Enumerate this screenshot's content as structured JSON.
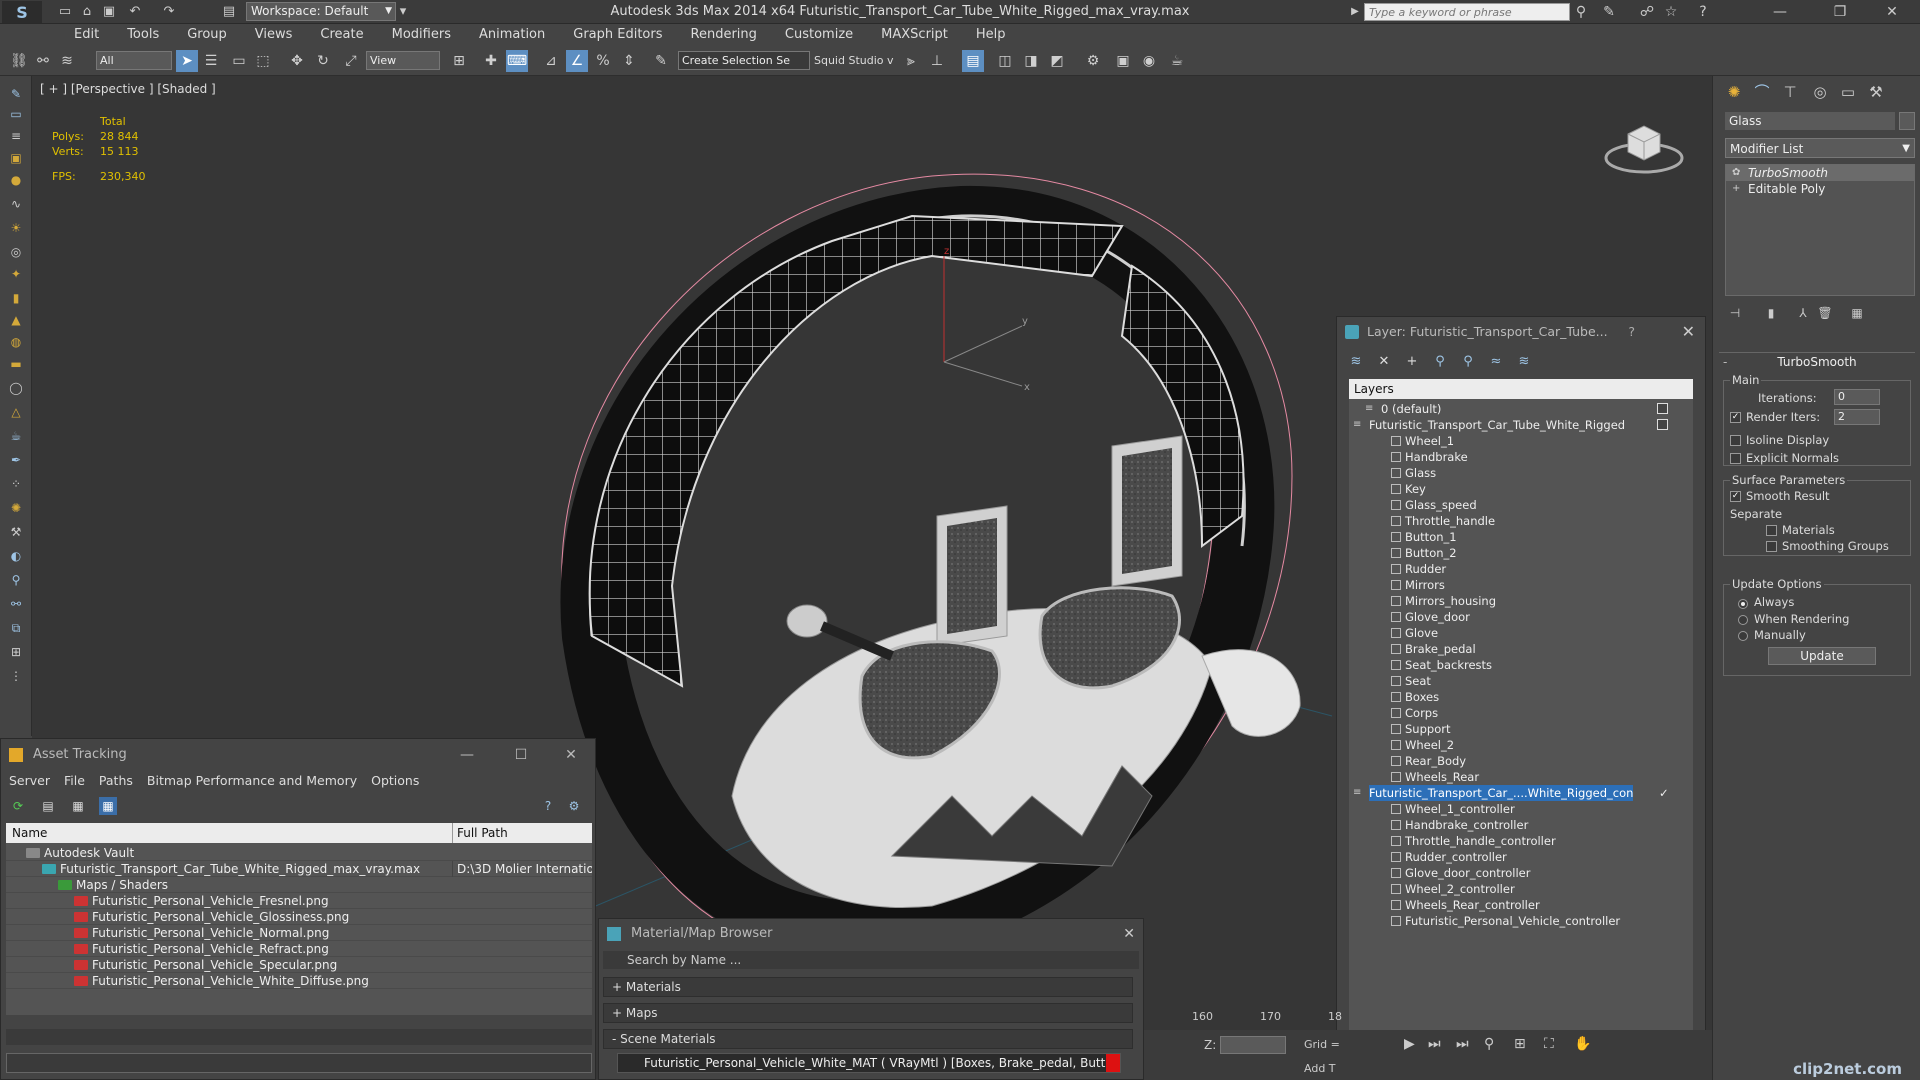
{
  "titlebar": {
    "workspace": "Workspace: Default",
    "title": "Autodesk 3ds Max  2014 x64     Futuristic_Transport_Car_Tube_White_Rigged_max_vray.max",
    "search_placeholder": "Type a keyword or phrase"
  },
  "menu": [
    "Edit",
    "Tools",
    "Group",
    "Views",
    "Create",
    "Modifiers",
    "Animation",
    "Graph Editors",
    "Rendering",
    "Customize",
    "MAXScript",
    "Help"
  ],
  "toolbar": {
    "filter_select": "All",
    "ref_coord": "View",
    "selection_set": "Create Selection Se",
    "squid": "Squid Studio v"
  },
  "viewport": {
    "label": "[ + ] [Perspective ] [Shaded ]",
    "stats": {
      "total_label": "Total",
      "polys_label": "Polys:",
      "polys": "28 844",
      "verts_label": "Verts:",
      "verts": "15 113",
      "fps_label": "FPS:",
      "fps": "230,340"
    },
    "gizmo": {
      "z": "z",
      "y": "y",
      "x": "x"
    }
  },
  "command_panel": {
    "object_name": "Glass",
    "modifier_list": "Modifier List",
    "stack": [
      "TurboSmooth",
      "Editable Poly"
    ],
    "turbosmooth": {
      "title": "TurboSmooth",
      "main_label": "Main",
      "iterations_label": "Iterations:",
      "iterations": "0",
      "render_iters_label": "Render Iters:",
      "render_iters": "2",
      "render_iters_checked": true,
      "isoline": "Isoline Display",
      "explicit_normals": "Explicit Normals",
      "surface_params": "Surface Parameters",
      "smooth_result": "Smooth Result",
      "smooth_result_checked": true,
      "separate": "Separate",
      "materials": "Materials",
      "smoothing_groups": "Smoothing Groups",
      "update_options": "Update Options",
      "always": "Always",
      "when_rendering": "When Rendering",
      "manually": "Manually",
      "update_button": "Update"
    }
  },
  "layer_explorer": {
    "title": "Layer: Futuristic_Transport_Car_Tube...",
    "help": "?",
    "header": "Layers",
    "rows": [
      {
        "label": "0 (default)",
        "indent": 1,
        "type": "layer",
        "vis": true
      },
      {
        "label": "Futuristic_Transport_Car_Tube_White_Rigged",
        "indent": 0,
        "type": "layer",
        "vis": true
      },
      {
        "label": "Wheel_1",
        "indent": 2,
        "type": "obj"
      },
      {
        "label": "Handbrake",
        "indent": 2,
        "type": "obj"
      },
      {
        "label": "Glass",
        "indent": 2,
        "type": "obj"
      },
      {
        "label": "Key",
        "indent": 2,
        "type": "obj"
      },
      {
        "label": "Glass_speed",
        "indent": 2,
        "type": "obj"
      },
      {
        "label": "Throttle_handle",
        "indent": 2,
        "type": "obj"
      },
      {
        "label": "Button_1",
        "indent": 2,
        "type": "obj"
      },
      {
        "label": "Button_2",
        "indent": 2,
        "type": "obj"
      },
      {
        "label": "Rudder",
        "indent": 2,
        "type": "obj"
      },
      {
        "label": "Mirrors",
        "indent": 2,
        "type": "obj"
      },
      {
        "label": "Mirrors_housing",
        "indent": 2,
        "type": "obj"
      },
      {
        "label": "Glove_door",
        "indent": 2,
        "type": "obj"
      },
      {
        "label": "Glove",
        "indent": 2,
        "type": "obj"
      },
      {
        "label": "Brake_pedal",
        "indent": 2,
        "type": "obj"
      },
      {
        "label": "Seat_backrests",
        "indent": 2,
        "type": "obj"
      },
      {
        "label": "Seat",
        "indent": 2,
        "type": "obj"
      },
      {
        "label": "Boxes",
        "indent": 2,
        "type": "obj"
      },
      {
        "label": "Corps",
        "indent": 2,
        "type": "obj"
      },
      {
        "label": "Support",
        "indent": 2,
        "type": "obj"
      },
      {
        "label": "Wheel_2",
        "indent": 2,
        "type": "obj"
      },
      {
        "label": "Rear_Body",
        "indent": 2,
        "type": "obj"
      },
      {
        "label": "Wheels_Rear",
        "indent": 2,
        "type": "obj"
      },
      {
        "label": "Futuristic_Transport_Car_....White_Rigged_con",
        "indent": 0,
        "type": "layer",
        "selected": true,
        "check": true
      },
      {
        "label": "Wheel_1_controller",
        "indent": 2,
        "type": "obj"
      },
      {
        "label": "Handbrake_controller",
        "indent": 2,
        "type": "obj"
      },
      {
        "label": "Throttle_handle_controller",
        "indent": 2,
        "type": "obj"
      },
      {
        "label": "Rudder_controller",
        "indent": 2,
        "type": "obj"
      },
      {
        "label": "Glove_door_controller",
        "indent": 2,
        "type": "obj"
      },
      {
        "label": "Wheel_2_controller",
        "indent": 2,
        "type": "obj"
      },
      {
        "label": "Wheels_Rear_controller",
        "indent": 2,
        "type": "obj"
      },
      {
        "label": "Futuristic_Personal_Vehicle_controller",
        "indent": 2,
        "type": "obj"
      }
    ]
  },
  "asset_tracking": {
    "title": "Asset Tracking",
    "menu": [
      "Server",
      "File",
      "Paths",
      "Bitmap Performance and Memory",
      "Options"
    ],
    "col_name": "Name",
    "col_path": "Full Path",
    "rows": [
      {
        "name": "Autodesk Vault",
        "indent": 1,
        "path": "",
        "icon": "vault"
      },
      {
        "name": "Futuristic_Transport_Car_Tube_White_Rigged_max_vray.max",
        "indent": 2,
        "path": "D:\\3D Molier Internatio",
        "icon": "max"
      },
      {
        "name": "Maps / Shaders",
        "indent": 3,
        "path": "",
        "icon": "maps"
      },
      {
        "name": "Futuristic_Personal_Vehicle_Fresnel.png",
        "indent": 4,
        "path": "",
        "icon": "png"
      },
      {
        "name": "Futuristic_Personal_Vehicle_Glossiness.png",
        "indent": 4,
        "path": "",
        "icon": "png"
      },
      {
        "name": "Futuristic_Personal_Vehicle_Normal.png",
        "indent": 4,
        "path": "",
        "icon": "png"
      },
      {
        "name": "Futuristic_Personal_Vehicle_Refract.png",
        "indent": 4,
        "path": "",
        "icon": "png"
      },
      {
        "name": "Futuristic_Personal_Vehicle_Specular.png",
        "indent": 4,
        "path": "",
        "icon": "png"
      },
      {
        "name": "Futuristic_Personal_Vehicle_White_Diffuse.png",
        "indent": 4,
        "path": "",
        "icon": "png"
      }
    ]
  },
  "material_browser": {
    "title": "Material/Map Browser",
    "search_placeholder": "Search by Name ...",
    "groups": [
      "+ Materials",
      "+ Maps",
      "- Scene Materials"
    ],
    "item": "Futuristic_Personal_Vehicle_White_MAT ( VRayMtl ) [Boxes, Brake_pedal, Butto..."
  },
  "timeline": {
    "t160": "160",
    "t170": "170",
    "t180": "18",
    "z_label": "Z:",
    "grid_label": "Grid =",
    "add_t": "Add T"
  },
  "watermark": "clip2net.com",
  "colors": {
    "accent": "#2c6fb8",
    "stats": "#e0c000",
    "wireframe_pink": "#e58aa3"
  }
}
